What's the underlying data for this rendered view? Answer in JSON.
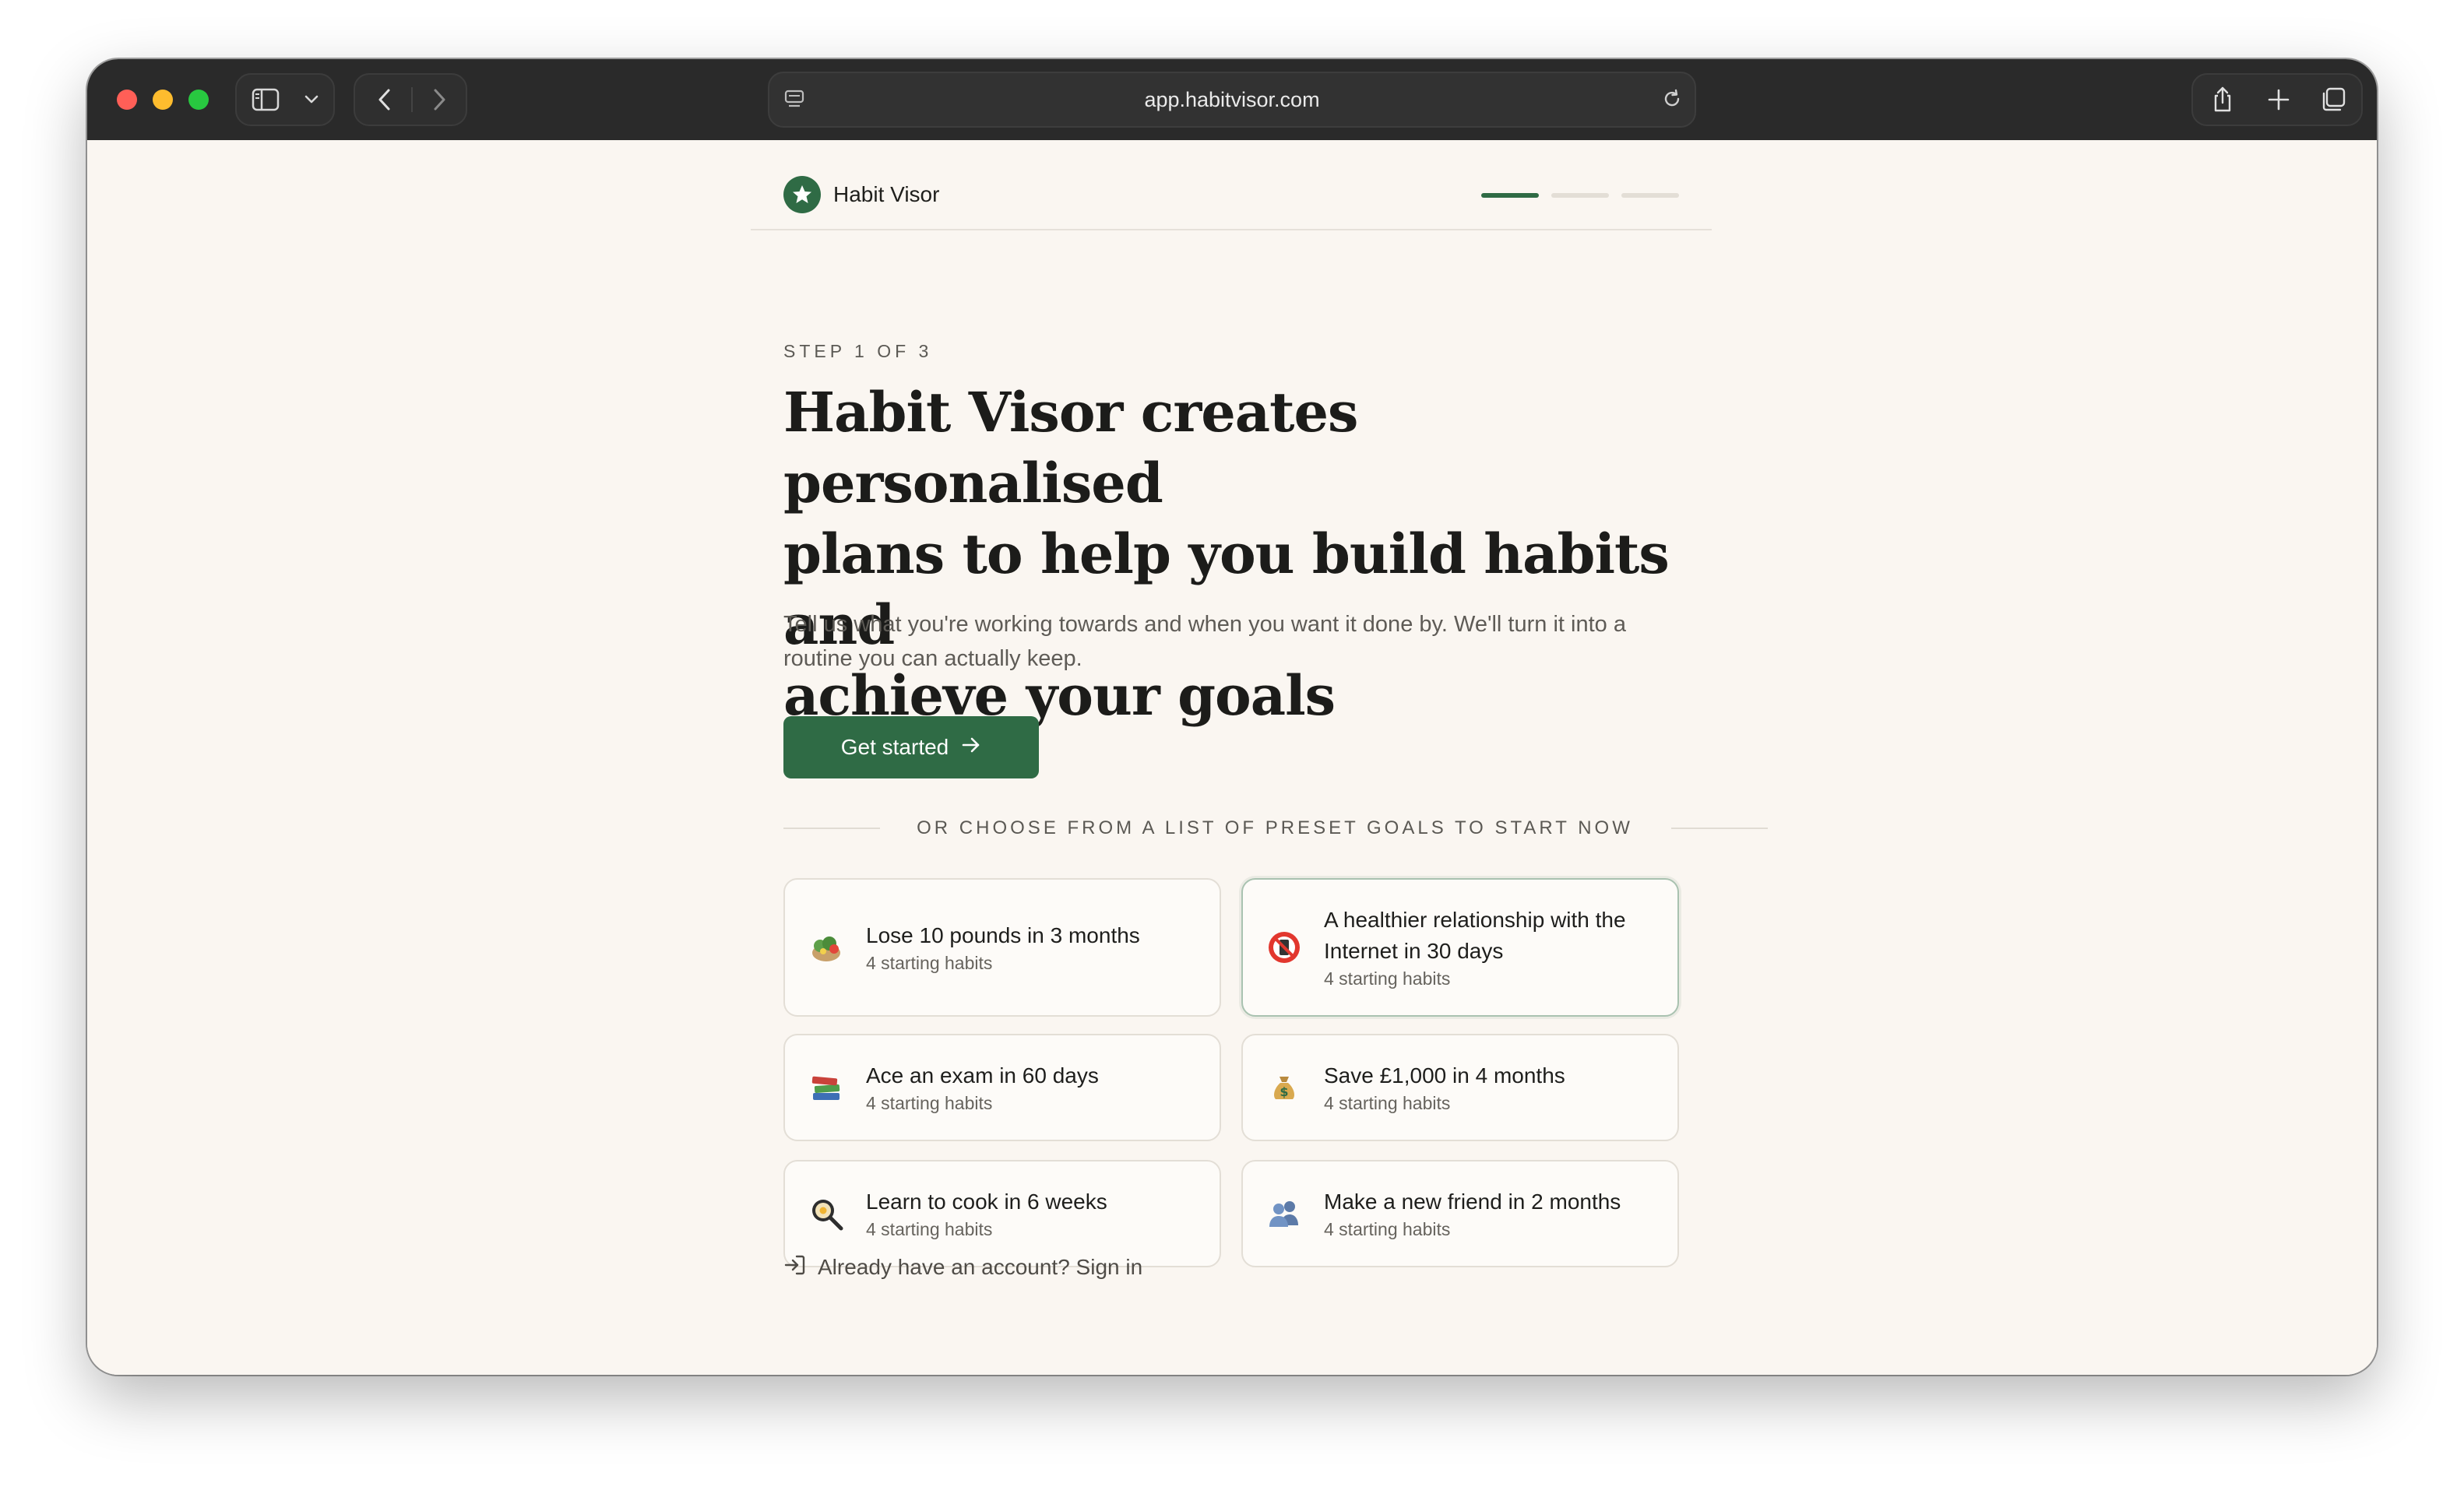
{
  "browser": {
    "url": "app.habitvisor.com"
  },
  "header": {
    "brand": "Habit Visor",
    "progress_steps": 3,
    "progress_active": 1
  },
  "hero": {
    "step_label": "STEP 1 OF 3",
    "headline_lines": [
      "Habit Visor creates personalised",
      "plans to help you build habits and",
      "achieve your goals"
    ],
    "subtitle_lines": [
      "Tell us what you're working towards and when you want it done by. We'll turn it into a",
      "routine you can actually keep."
    ],
    "cta_label": "Get started"
  },
  "presets": {
    "divider_label": "OR CHOOSE FROM A LIST OF PRESET GOALS TO START NOW",
    "cards": [
      {
        "icon": "salad-icon",
        "title": "Lose 10 pounds in 3 months",
        "subtitle": "4 starting habits",
        "selected": false
      },
      {
        "icon": "no-phone-icon",
        "title_lines": [
          "A healthier relationship with the",
          "Internet in 30 days"
        ],
        "subtitle": "4 starting habits",
        "selected": true
      },
      {
        "icon": "books-icon",
        "title": "Ace an exam in 60 days",
        "subtitle": "4 starting habits",
        "selected": false
      },
      {
        "icon": "money-bag-icon",
        "title": "Save £1,000 in 4 months",
        "subtitle": "4 starting habits",
        "selected": false
      },
      {
        "icon": "frying-pan-icon",
        "title": "Learn to cook in 6 weeks",
        "subtitle": "4 starting habits",
        "selected": false
      },
      {
        "icon": "people-icon",
        "title": "Make a new friend in 2 months",
        "subtitle": "4 starting habits",
        "selected": false
      }
    ]
  },
  "footer": {
    "signin_label": "Already have an account? Sign in"
  },
  "colors": {
    "accent": "#2f6b45",
    "background": "#faf6f1",
    "card_border": "#e3ded6"
  }
}
